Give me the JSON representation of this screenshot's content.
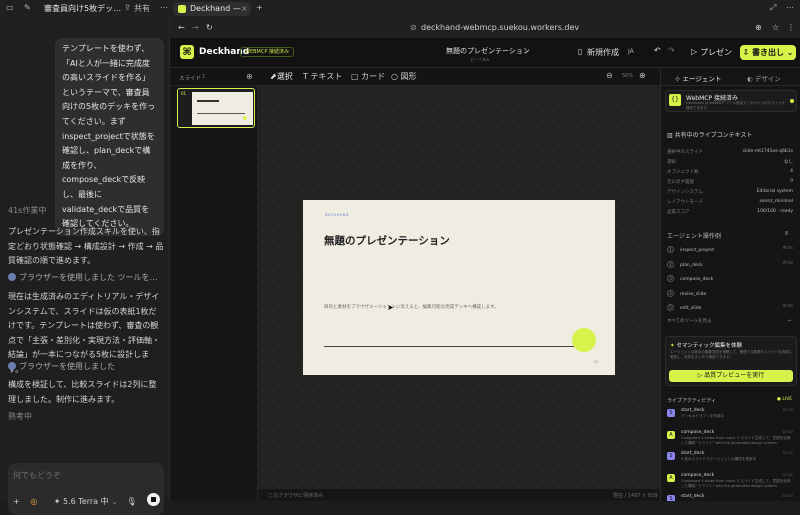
{
  "browser": {
    "tab_title": "審査員向け5枚デッ…",
    "share_label": "共有",
    "app_tab_title": "Deckhand —",
    "url": "deckhand-webmcp.suekou.workers.dev"
  },
  "chat": {
    "user_message": "テンプレートを使わず、「AIと人が一緒に完成度の高いスライドを作る」というテーマで、審査員向けの5枚のデッキを作ってください。まずinspect_projectで状態を確認し、plan_deckで構成を作り、compose_deckで反映し、最後にvalidate_deckで品質を確認してください。",
    "work_time": "41s作業中",
    "para1": "プレゼンテーション作成スキルを使い、指定どおり状態確認 → 構成設計 → 作成 → 品質確認の順で進めます。",
    "tool1": "ブラウザーを使用しました ツールを…",
    "para2": "現在は生成済みのエディトリアル・デザインシステムで、スライドは仮の表紙1枚だけです。テンプレートは使わず、審査の観点で「主張・差別化・実現方法・評価軸・結論」が一本につながる5枚に設計します。",
    "tool2": "ブラウザーを使用しました",
    "para3": "構成を検証して、比較スライドは2列に整理しました。制作に進みます。",
    "thinking": "熟考中",
    "composer_placeholder": "何でもどうぞ",
    "model_label": "5.6 Terra 中"
  },
  "app": {
    "brand": "Deckhand",
    "badge": "WEBMCP 接続済み",
    "doc_title": "無題のプレゼンテーション",
    "doc_sub": "セーブ済み",
    "new_label": "新規作成",
    "lang": "JA",
    "present_label": "プレゼン",
    "export_label": "書き出し",
    "tools": [
      "選択",
      "テキスト",
      "カード",
      "図形"
    ],
    "zoom": "50%",
    "slides_label": "スライド",
    "slide_count": "1",
    "thumb_num": "01",
    "status_left": "このブラウザに保存済み",
    "status_right": "現在 / 1497 × 839"
  },
  "slide": {
    "kicker": "DECKHAND",
    "title": "無題のプレゼンテーション",
    "body": "目的と素材をブラウザエージェントに伝えると、編集可能な完成デッキへ構成します。",
    "page": "01",
    "accent": "#d7f24a"
  },
  "panel": {
    "tab_agent": "エージェント",
    "tab_design": "デザイン",
    "webmcp_title": "WebMCP 接続済み",
    "webmcp_desc": "Deckhand は WebMCP ツール経由でこのページのスライドを操作できます",
    "context_title": "共有中のライブコンテキスト",
    "context": [
      {
        "k": "選択中のスライド",
        "v": "slide-mt1741es-q6b1s"
      },
      {
        "k": "選択",
        "v": "なし"
      },
      {
        "k": "オブジェクト数",
        "v": "4"
      },
      {
        "k": "元に戻す履歴",
        "v": "0"
      },
      {
        "k": "デザインシステム",
        "v": "Editorial system"
      },
      {
        "k": "レイアウトモード",
        "v": "sonnz_minimal"
      },
      {
        "k": "品質スコア",
        "v": "100/100 · ready"
      }
    ],
    "ops_title": "エージェント操作例",
    "ops_count": "8",
    "ops": [
      {
        "n": "1",
        "name": "inspect_project",
        "t": "#ctx"
      },
      {
        "n": "2",
        "name": "plan_deck",
        "t": "#ctx"
      },
      {
        "n": "3",
        "name": "compose_deck",
        "t": ""
      },
      {
        "n": "4",
        "name": "revise_slide",
        "t": ""
      },
      {
        "n": "5",
        "name": "edit_slide",
        "t": "#ctx"
      }
    ],
    "all_tools": "すべてのツールを見る",
    "semantic_title": "セマンティック編集を体験",
    "semantic_desc": "エージェントは既存の編集意図を理解して、関連する要素やスライドを同時に更新し、品質をまとめて確認できます。",
    "preview_btn": "品質プレビューを実行",
    "activity_title": "ライブアクティビティ",
    "live": "LIVE",
    "activity": [
      {
        "name": "start_deck",
        "desc": "デッキのドラフトを作成中",
        "time": "07:22",
        "color": "#8b86f0",
        "init": "S"
      },
      {
        "name": "compose_deck",
        "desc": "Composed 4 slides from input. 5 スライド生成して、意図を反映した構成 \"ドラフト\" with the generated design system",
        "time": "07:22",
        "color": "#d7f24a",
        "init": "A"
      },
      {
        "name": "start_deck",
        "desc": "5 枚のスライドでエージェントの構成を更新中",
        "time": "07:21",
        "color": "#8b86f0",
        "init": "S"
      },
      {
        "name": "compose_deck",
        "desc": "Composed 5 slides from input. 5 スライド生成して、意図を反映した構成 \"ドラフト\" with the generated design system",
        "time": "07:21",
        "color": "#d7f24a",
        "init": "A"
      },
      {
        "name": "start_deck",
        "desc": "",
        "time": "07:20",
        "color": "#8b86f0",
        "init": "S"
      }
    ]
  }
}
